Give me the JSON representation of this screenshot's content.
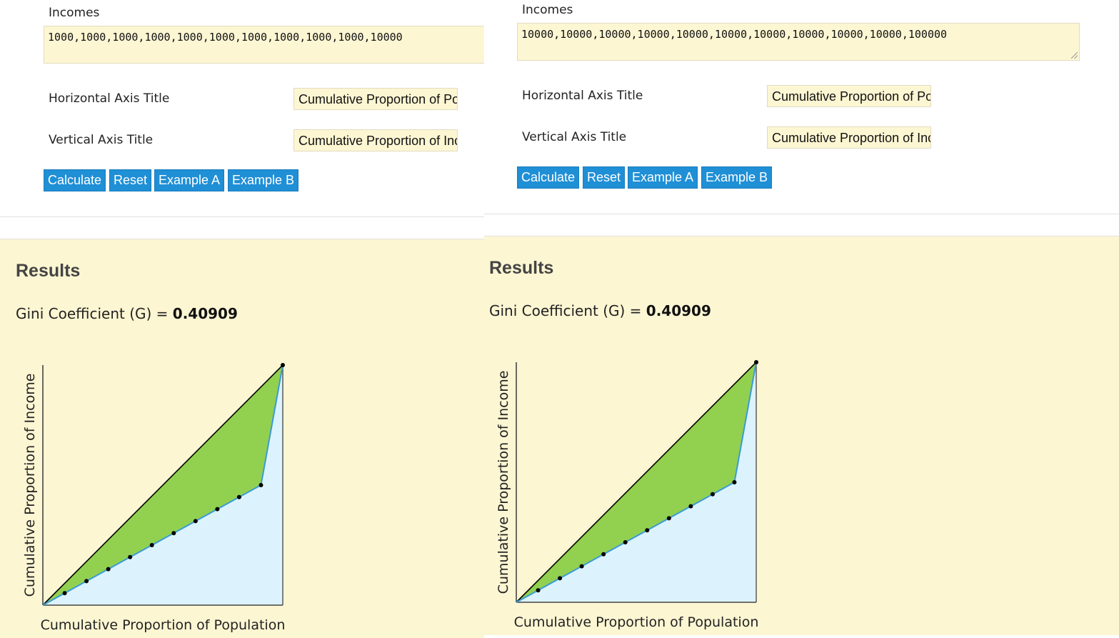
{
  "panels": [
    {
      "id": "left",
      "form": {
        "incomes_label": "Incomes",
        "incomes_value": "1000,1000,1000,1000,1000,1000,1000,1000,1000,1000,10000",
        "horizontal_axis_label": "Horizontal Axis Title",
        "horizontal_axis_value": "Cumulative Proportion of Population",
        "vertical_axis_label": "Vertical Axis Title",
        "vertical_axis_value": "Cumulative Proportion of Income",
        "buttons": [
          "Calculate",
          "Reset",
          "Example A",
          "Example B"
        ]
      },
      "results": {
        "title": "Results",
        "gini_label": "Gini Coefficient (G) = ",
        "gini_value": "0.40909"
      }
    },
    {
      "id": "right",
      "form": {
        "incomes_label": "Incomes",
        "incomes_value": "10000,10000,10000,10000,10000,10000,10000,10000,10000,10000,100000",
        "horizontal_axis_label": "Horizontal Axis Title",
        "horizontal_axis_value": "Cumulative Proportion of Population",
        "vertical_axis_label": "Vertical Axis Title",
        "vertical_axis_value": "Cumulative Proportion of Income",
        "buttons": [
          "Calculate",
          "Reset",
          "Example A",
          "Example B"
        ]
      },
      "results": {
        "title": "Results",
        "gini_label": "Gini Coefficient (G) = ",
        "gini_value": "0.40909"
      }
    }
  ],
  "colors": {
    "button": "#1f8fd6",
    "input_bg": "#fdf6d3",
    "results_bg": "#fdf6d3",
    "inequality_area": "#92d050",
    "lorenz_area": "#dcf3fd",
    "lorenz_line": "#3a9bd6",
    "equality_line": "#000000"
  },
  "chart_data": [
    {
      "type": "area",
      "xlabel": "Cumulative Proportion of Population",
      "ylabel": "Cumulative Proportion of Income",
      "xlim": [
        0,
        1
      ],
      "ylim": [
        0,
        1
      ],
      "series": [
        {
          "name": "",
          "x": [
            0,
            0.0909,
            0.1818,
            0.2727,
            0.3636,
            0.4545,
            0.5455,
            0.6364,
            0.7273,
            0.8182,
            0.9091,
            1
          ],
          "y": [
            0,
            0.05,
            0.1,
            0.15,
            0.2,
            0.25,
            0.3,
            0.35,
            0.4,
            0.45,
            0.5,
            1
          ]
        }
      ]
    },
    {
      "type": "area",
      "xlabel": "Cumulative Proportion of Population",
      "ylabel": "Cumulative Proportion of Income",
      "xlim": [
        0,
        1
      ],
      "ylim": [
        0,
        1
      ],
      "series": [
        {
          "name": "",
          "x": [
            0,
            0.0909,
            0.1818,
            0.2727,
            0.3636,
            0.4545,
            0.5455,
            0.6364,
            0.7273,
            0.8182,
            0.9091,
            1
          ],
          "y": [
            0,
            0.05,
            0.1,
            0.15,
            0.2,
            0.25,
            0.3,
            0.35,
            0.4,
            0.45,
            0.5,
            1
          ]
        }
      ]
    }
  ]
}
